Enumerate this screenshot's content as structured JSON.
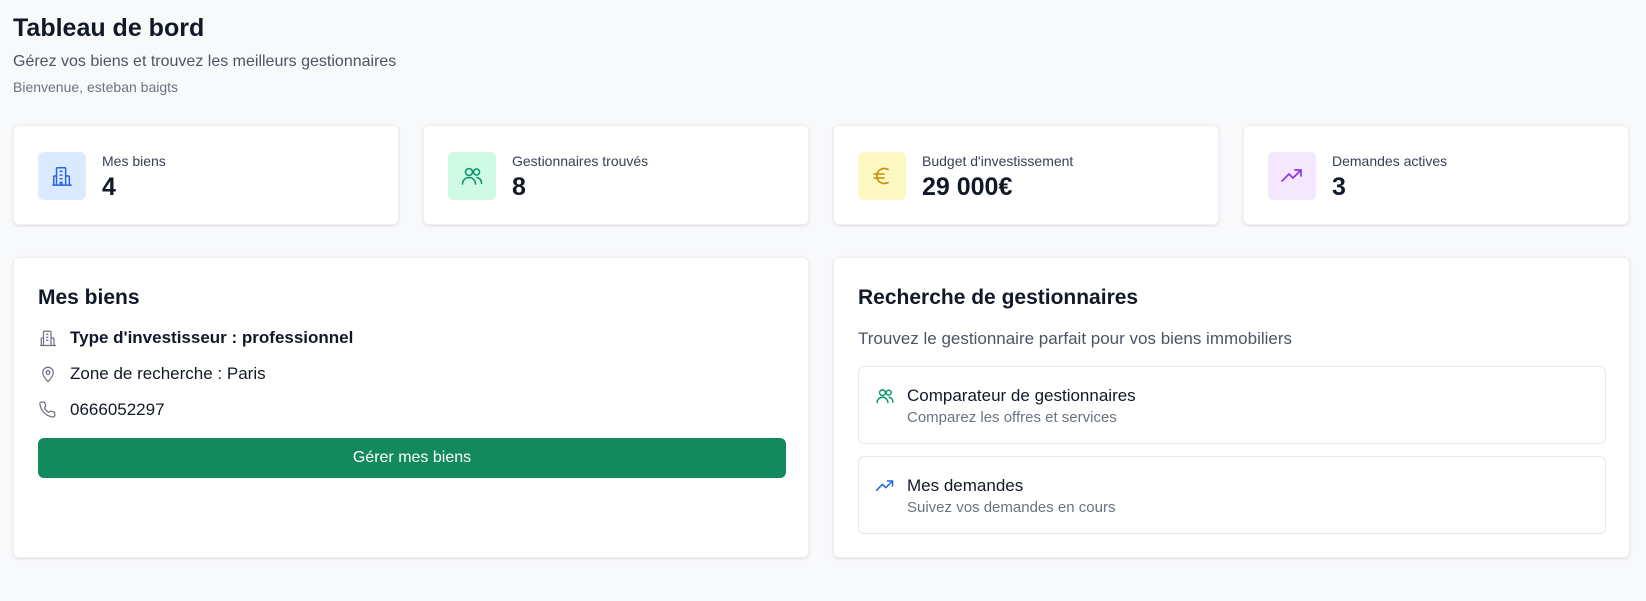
{
  "header": {
    "title": "Tableau de bord",
    "subtitle": "Gérez vos biens et trouvez les meilleurs gestionnaires",
    "welcome": "Bienvenue, esteban baigts"
  },
  "stats": [
    {
      "label": "Mes biens",
      "value": "4",
      "icon": "building-icon",
      "color": "#2563eb",
      "bg": "#dbeafe"
    },
    {
      "label": "Gestionnaires trouvés",
      "value": "8",
      "icon": "users-icon",
      "color": "#059669",
      "bg": "#d1fae5"
    },
    {
      "label": "Budget d'investissement",
      "value": "29 000€",
      "icon": "euro-icon",
      "color": "#ca8a04",
      "bg": "#fef9c3"
    },
    {
      "label": "Demandes actives",
      "value": "3",
      "icon": "trending-up-icon",
      "color": "#9333ea",
      "bg": "#f3e8ff"
    }
  ],
  "properties_panel": {
    "title": "Mes biens",
    "investor_type": "Type d'investisseur : professionnel",
    "search_zone": "Zone de recherche : Paris",
    "phone": "0666052297",
    "manage_button": "Gérer mes biens",
    "button_color": "#128a5e"
  },
  "search_panel": {
    "title": "Recherche de gestionnaires",
    "description": "Trouvez le gestionnaire parfait pour vos biens immobiliers",
    "options": [
      {
        "title": "Comparateur de gestionnaires",
        "description": "Comparez les offres et services",
        "icon": "users-icon",
        "color": "#059669"
      },
      {
        "title": "Mes demandes",
        "description": "Suivez vos demandes en cours",
        "icon": "trending-up-icon",
        "color": "#2563eb"
      }
    ]
  }
}
